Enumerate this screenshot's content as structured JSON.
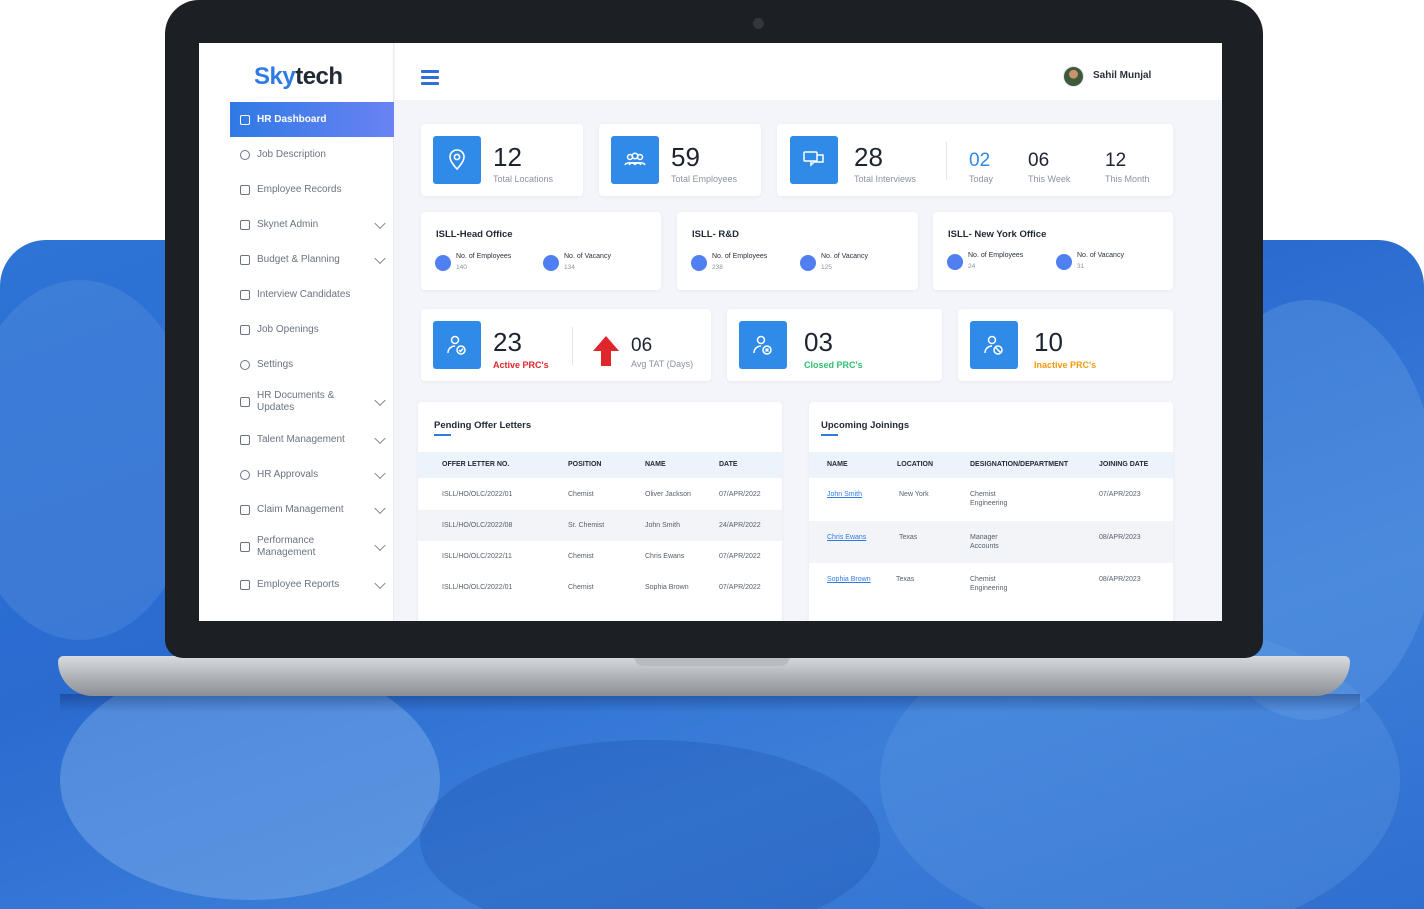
{
  "brand": {
    "logo_a": "Sky",
    "logo_b": "tech"
  },
  "user": {
    "name": "Sahil Munjal"
  },
  "sidebar": {
    "items": [
      {
        "label": "HR Dashboard",
        "active": true,
        "chevron": false
      },
      {
        "label": "Job Description",
        "chevron": false
      },
      {
        "label": "Employee Records",
        "chevron": false
      },
      {
        "label": "Skynet Admin",
        "chevron": true
      },
      {
        "label": "Budget & Planning",
        "chevron": true
      },
      {
        "label": "Interview Candidates",
        "chevron": false
      },
      {
        "label": "Job Openings",
        "chevron": false
      },
      {
        "label": "Settings",
        "chevron": false
      },
      {
        "label": "HR Documents & Updates",
        "chevron": true
      },
      {
        "label": "Talent Management",
        "chevron": true
      },
      {
        "label": "HR Approvals",
        "chevron": true
      },
      {
        "label": "Claim Management",
        "chevron": true
      },
      {
        "label": "Performance Management",
        "chevron": true
      },
      {
        "label": "Employee Reports",
        "chevron": true
      }
    ]
  },
  "stats": {
    "locations": {
      "value": "12",
      "label": "Total Locations"
    },
    "employees": {
      "value": "59",
      "label": "Total Employees"
    },
    "interviews": {
      "value": "28",
      "label": "Total Interviews"
    },
    "today": {
      "value": "02",
      "label": "Today"
    },
    "week": {
      "value": "06",
      "label": "This Week"
    },
    "month": {
      "value": "12",
      "label": "This Month"
    }
  },
  "offices": [
    {
      "name": "ISLL-Head Office",
      "emp_label": "No. of Employees",
      "emp": "140",
      "vac_label": "No. of Vacancy",
      "vac": "134"
    },
    {
      "name": "ISLL- R&D",
      "emp_label": "No. of Employees",
      "emp": "238",
      "vac_label": "No. of Vacancy",
      "vac": "125"
    },
    {
      "name": "ISLL- New York Office",
      "emp_label": "No. of Employees",
      "emp": "24",
      "vac_label": "No. of Vacancy",
      "vac": "31"
    }
  ],
  "prc": {
    "active": {
      "value": "23",
      "label": "Active PRC's"
    },
    "tat": {
      "value": "06",
      "label": "Avg TAT (Days)"
    },
    "closed": {
      "value": "03",
      "label": "Closed PRC's"
    },
    "inactive": {
      "value": "10",
      "label": "Inactive PRC's"
    }
  },
  "colors": {
    "accent": "#2f8ae8",
    "active": "#e0252b",
    "closed": "#2fbf71",
    "inactive": "#f29a0e"
  },
  "pending": {
    "title": "Pending Offer Letters",
    "headers": [
      "OFFER LETTER NO.",
      "POSITION",
      "NAME",
      "DATE"
    ],
    "rows": [
      [
        "ISLL/HO/OLC/2022/01",
        "Chemist",
        "Oliver Jackson",
        "07/APR/2022"
      ],
      [
        "ISLL/HO/OLC/2022/08",
        "Sr. Chemist",
        "John Smith",
        "24/APR/2022"
      ],
      [
        "ISLL/HO/OLC/2022/11",
        "Chemist",
        "Chris Ewans",
        "07/APR/2022"
      ],
      [
        "ISLL/HO/OLC/2022/01",
        "Chemist",
        "Sophia Brown",
        "07/APR/2022"
      ]
    ]
  },
  "joinings": {
    "title": "Upcoming Joinings",
    "headers": [
      "NAME",
      "LOCATION",
      "DESIGNATION/DEPARTMENT",
      "JOINING DATE"
    ],
    "rows": [
      {
        "name": "John Smith",
        "location": "New York",
        "designation": "Chemist",
        "department": "Engineering",
        "date": "07/APR/2023"
      },
      {
        "name": "Chris Ewans",
        "location": "Texas",
        "designation": "Manager",
        "department": "Accounts",
        "date": "08/APR/2023"
      },
      {
        "name": "Sophia Brown",
        "location": "Texas",
        "designation": "Chemist",
        "department": "Engineering",
        "date": "08/APR/2023"
      }
    ]
  }
}
